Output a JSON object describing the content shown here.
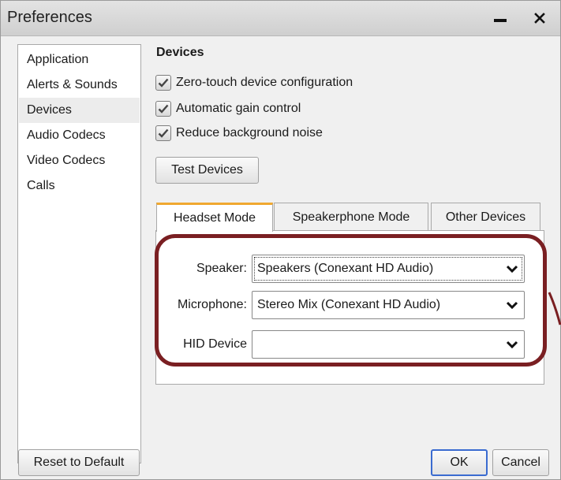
{
  "window": {
    "title": "Preferences",
    "minimize_glyph": "—",
    "close_glyph": "✕"
  },
  "sidebar": {
    "items": [
      {
        "label": "Application",
        "selected": false
      },
      {
        "label": "Alerts & Sounds",
        "selected": false
      },
      {
        "label": "Devices",
        "selected": true
      },
      {
        "label": "Audio Codecs",
        "selected": false
      },
      {
        "label": "Video Codecs",
        "selected": false
      },
      {
        "label": "Calls",
        "selected": false
      }
    ]
  },
  "devices": {
    "section_title": "Devices",
    "checkboxes": [
      {
        "label": "Zero-touch device configuration",
        "checked": true
      },
      {
        "label": "Automatic gain control",
        "checked": true
      },
      {
        "label": "Reduce background noise",
        "checked": true
      }
    ],
    "test_button": "Test Devices",
    "tabs": [
      {
        "label": "Headset Mode",
        "active": true
      },
      {
        "label": "Speakerphone Mode",
        "active": false
      },
      {
        "label": "Other Devices",
        "active": false
      }
    ],
    "fields": {
      "speaker": {
        "label": "Speaker:",
        "value": "Speakers (Conexant HD Audio)"
      },
      "microphone": {
        "label": "Microphone:",
        "value": "Stereo Mix (Conexant HD Audio)"
      },
      "hid": {
        "label": "HID Device",
        "value": ""
      }
    }
  },
  "footer": {
    "reset": "Reset to Default",
    "ok": "OK",
    "cancel": "Cancel"
  },
  "colors": {
    "highlight": "#7a1f22",
    "tab_accent": "#f0a830",
    "ok_border": "#3a6bd0"
  },
  "icons": {
    "checkbox": "checkmark-icon",
    "dropdown": "chevron-down-icon"
  }
}
